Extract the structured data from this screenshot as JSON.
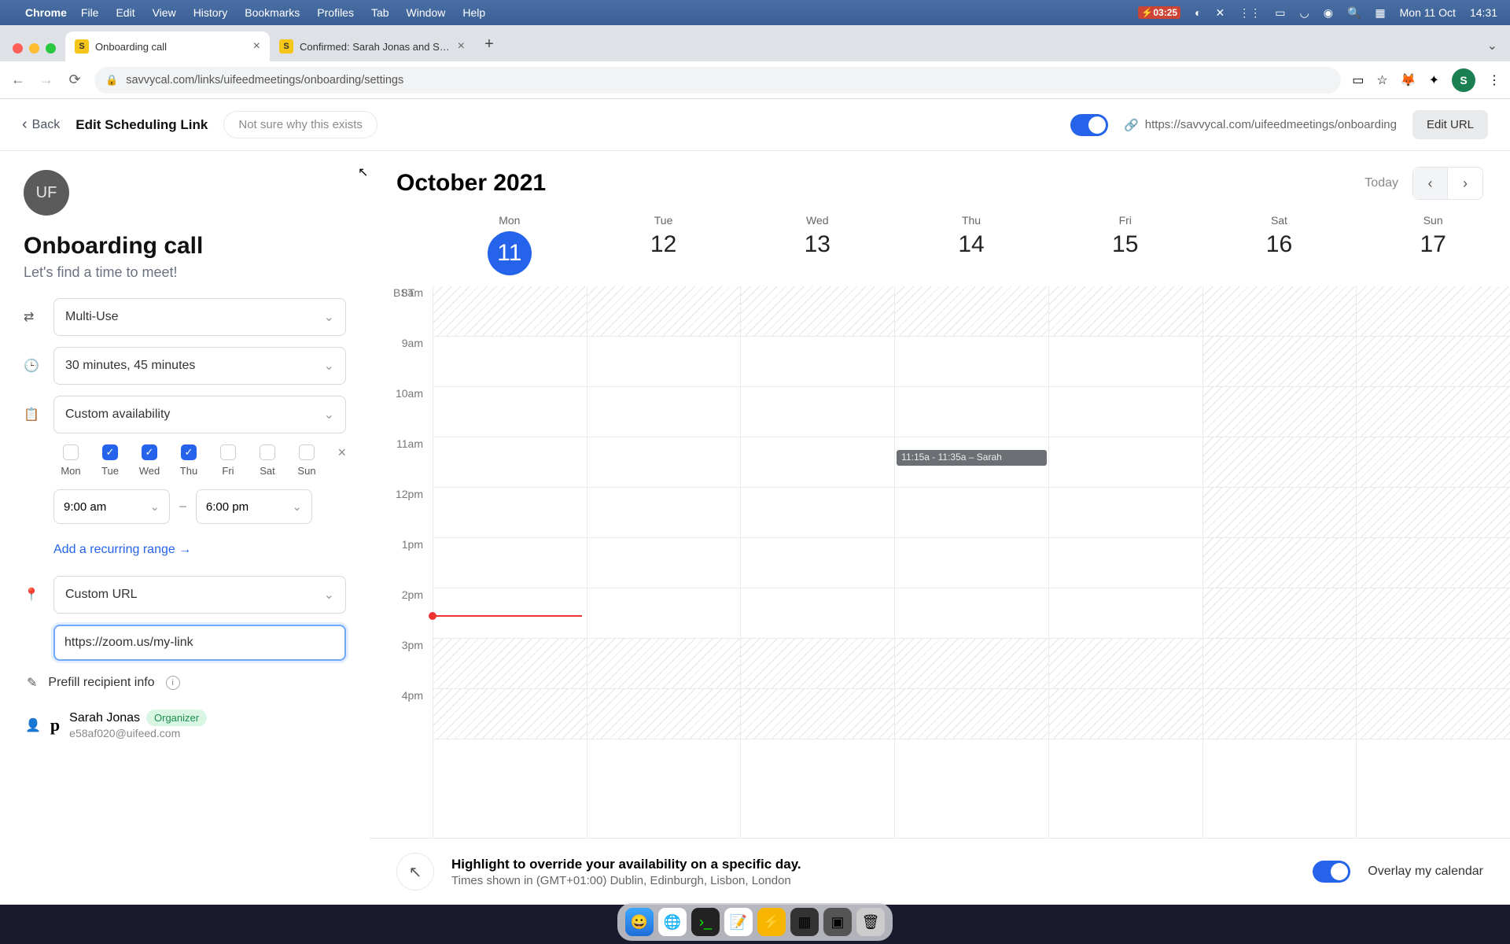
{
  "menubar": {
    "app": "Chrome",
    "items": [
      "File",
      "Edit",
      "View",
      "History",
      "Bookmarks",
      "Profiles",
      "Tab",
      "Window",
      "Help"
    ],
    "battery_time": "03:25",
    "date": "Mon 11 Oct",
    "clock": "14:31"
  },
  "browser": {
    "tabs": [
      {
        "title": "Onboarding call",
        "active": true
      },
      {
        "title": "Confirmed: Sarah Jonas and S…",
        "active": false
      }
    ],
    "url": "savvycal.com/links/uifeedmeetings/onboarding/settings",
    "avatar_letter": "S"
  },
  "header": {
    "back": "Back",
    "title": "Edit Scheduling Link",
    "note": "Not sure why this exists",
    "share_url": "https://savvycal.com/uifeedmeetings/onboarding",
    "edit_url": "Edit URL"
  },
  "sidebar": {
    "avatar": "UF",
    "title": "Onboarding call",
    "subtitle": "Let's find a time to meet!",
    "link_type": "Multi-Use",
    "durations": "30 minutes, 45 minutes",
    "availability": "Custom availability",
    "days": [
      {
        "abbr": "Mon",
        "on": false
      },
      {
        "abbr": "Tue",
        "on": true
      },
      {
        "abbr": "Wed",
        "on": true
      },
      {
        "abbr": "Thu",
        "on": true
      },
      {
        "abbr": "Fri",
        "on": false
      },
      {
        "abbr": "Sat",
        "on": false
      },
      {
        "abbr": "Sun",
        "on": false
      }
    ],
    "start_time": "9:00 am",
    "end_time": "6:00 pm",
    "recurring": "Add a recurring range →",
    "location_type": "Custom URL",
    "location_value": "https://zoom.us/my-link",
    "prefill": "Prefill recipient info",
    "organizer_name": "Sarah Jonas",
    "organizer_tag": "Organizer",
    "organizer_email": "e58af020@uifeed.com"
  },
  "calendar": {
    "month": "October 2021",
    "today": "Today",
    "timezone": "BST",
    "days": [
      {
        "dow": "Mon",
        "num": "11",
        "today": true
      },
      {
        "dow": "Tue",
        "num": "12"
      },
      {
        "dow": "Wed",
        "num": "13"
      },
      {
        "dow": "Thu",
        "num": "14"
      },
      {
        "dow": "Fri",
        "num": "15"
      },
      {
        "dow": "Sat",
        "num": "16"
      },
      {
        "dow": "Sun",
        "num": "17"
      }
    ],
    "hours": [
      "8am",
      "9am",
      "10am",
      "11am",
      "12pm",
      "1pm",
      "2pm",
      "3pm",
      "4pm"
    ],
    "event_label": "11:15a - 11:35a – Sarah",
    "footer_bold": "Highlight to override your availability on a specific day.",
    "footer_sub": "Times shown in (GMT+01:00) Dublin, Edinburgh, Lisbon, London",
    "overlay": "Overlay my calendar"
  }
}
